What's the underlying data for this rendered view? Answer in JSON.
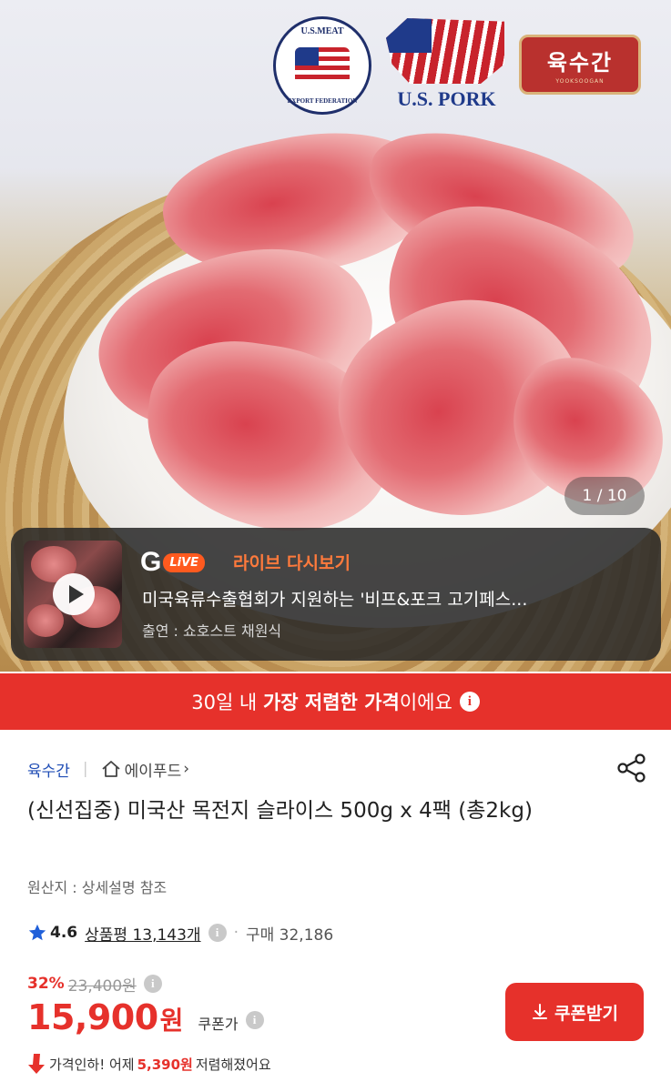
{
  "hero": {
    "seal_top": "U.S.MEAT",
    "seal_bottom": "EXPORT FEDERATION",
    "pork_text": "U.S. PORK",
    "shop_logo_name": "육수간",
    "shop_logo_sub": "YOOKSOOGAN",
    "image_counter": "1 / 10"
  },
  "live": {
    "g_letter": "G",
    "live_label": "LiVE",
    "title": "라이브 다시보기",
    "description": "미국육류수출협회가 지원하는 '비프&포크 고기페스...",
    "host": "출연 : 쇼호스트 채원식"
  },
  "lowest_price": {
    "prefix": "30일 내 ",
    "emphasis": "가장 저렴한 가격",
    "suffix": "이에요",
    "info": "i"
  },
  "product": {
    "store": "육수간",
    "brand": "에이푸드",
    "brand_chevron": "›",
    "title": "(신선집중) 미국산 목전지 슬라이스 500g x 4팩 (총2kg)",
    "origin": "원산지 : 상세설명 참조",
    "rating": "4.6",
    "review_label": "상품평 13,143개",
    "purchase_label": "구매 32,186",
    "mid_dot": "·",
    "info": "i",
    "discount_rate": "32%",
    "original_price": "23,400원",
    "price": "15,900",
    "price_unit": "원",
    "coupon_price_label": "쿠폰가",
    "coupon_button": "쿠폰받기",
    "drop_prefix": "가격인하! 어제",
    "drop_amount": "5,390원",
    "drop_suffix": "저렴해졌어요"
  },
  "colors": {
    "accent_red": "#e6312b",
    "link_blue": "#1f4db5",
    "live_orange": "#ff7a3c"
  },
  "icons": [
    "home-icon",
    "share-icon",
    "star-icon",
    "info-icon",
    "download-icon",
    "price-drop-arrow-icon",
    "play-icon"
  ]
}
